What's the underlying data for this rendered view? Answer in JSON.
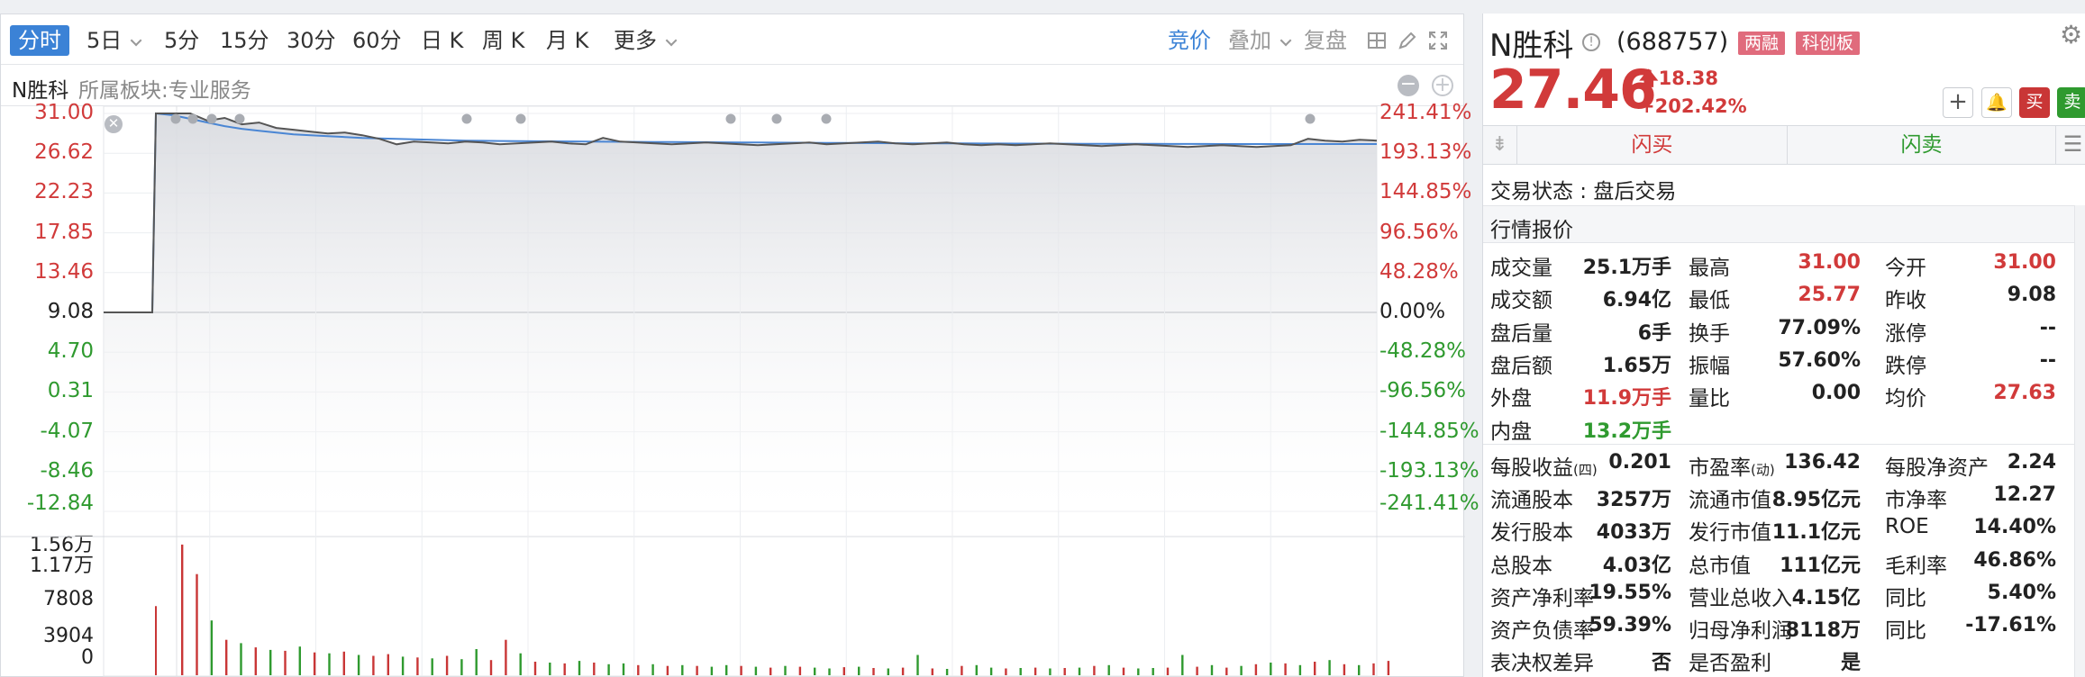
{
  "toolbar": {
    "period_tabs": [
      {
        "label": "分时",
        "active": true
      },
      {
        "label": "5日",
        "dropdown": true
      },
      {
        "label": "5分"
      },
      {
        "label": "15分"
      },
      {
        "label": "30分"
      },
      {
        "label": "60分"
      },
      {
        "label": "日 K"
      },
      {
        "label": "周 K"
      },
      {
        "label": "月 K"
      },
      {
        "label": "更多",
        "dropdown": true
      }
    ],
    "right_tools": {
      "auction": "竞价",
      "overlay": "叠加",
      "replay": "复盘"
    }
  },
  "chart_header": {
    "stock_short": "N胜科",
    "sector": "所属板块:专业服务"
  },
  "axes": {
    "price_left": [
      "31.00",
      "26.62",
      "22.23",
      "17.85",
      "13.46",
      "9.08",
      "4.70",
      "0.31",
      "-4.07",
      "-8.46",
      "-12.84"
    ],
    "pct_right": [
      "241.41%",
      "193.13%",
      "144.85%",
      "96.56%",
      "48.28%",
      "0.00%",
      "-48.28%",
      "-96.56%",
      "-144.85%",
      "-193.13%",
      "-241.41%"
    ],
    "volume_left": [
      "1.56万",
      "1.17万",
      "7808",
      "3904",
      "0"
    ]
  },
  "chart_data": {
    "type": "line",
    "prev_close": 9.08,
    "ylim": [
      -12.84,
      31.0
    ],
    "series": [
      {
        "name": "price",
        "color": "#555555",
        "values": [
          9.08,
          9.08,
          9.08,
          31.0,
          31.0,
          31.0,
          30.2,
          30.5,
          29.8,
          30.0,
          29.4,
          29.2,
          29.0,
          28.8,
          28.9,
          28.6,
          28.2,
          27.6,
          27.9,
          27.8,
          27.7,
          27.9,
          27.8,
          27.6,
          27.7,
          27.8,
          27.9,
          27.7,
          27.6,
          28.3,
          27.9,
          27.8,
          27.7,
          27.6,
          27.7,
          27.8,
          27.7,
          27.6,
          27.5,
          27.6,
          27.7,
          27.8,
          27.6,
          27.7,
          27.8,
          27.9,
          27.7,
          27.6,
          27.7,
          27.8,
          27.6,
          27.5,
          27.6,
          27.5,
          27.6,
          27.7,
          27.6,
          27.5,
          27.4,
          27.5,
          27.6,
          27.5,
          27.4,
          27.3,
          27.4,
          27.5,
          27.4,
          27.3,
          27.4,
          27.5,
          28.2,
          28.0,
          27.9,
          28.1,
          28.0
        ]
      },
      {
        "name": "avg",
        "color": "#4a86d4",
        "values": [
          9.08,
          9.08,
          9.08,
          31.0,
          30.8,
          30.4,
          30.0,
          29.6,
          29.3,
          29.1,
          28.9,
          28.7,
          28.6,
          28.5,
          28.4,
          28.3,
          28.25,
          28.2,
          28.15,
          28.1,
          28.05,
          28.0,
          27.98,
          27.96,
          27.95,
          27.94,
          27.93,
          27.92,
          27.9,
          27.89,
          27.88,
          27.87,
          27.86,
          27.85,
          27.84,
          27.83,
          27.82,
          27.81,
          27.8,
          27.79,
          27.78,
          27.77,
          27.76,
          27.75,
          27.74,
          27.73,
          27.72,
          27.71,
          27.71,
          27.7,
          27.7,
          27.69,
          27.69,
          27.68,
          27.68,
          27.67,
          27.67,
          27.66,
          27.66,
          27.65,
          27.65,
          27.65,
          27.64,
          27.64,
          27.64,
          27.63,
          27.63,
          27.63,
          27.63,
          27.63,
          27.63,
          27.63,
          27.63,
          27.63,
          27.63
        ]
      }
    ],
    "volume": {
      "ylim": [
        0,
        15600
      ],
      "values": [
        15500,
        12000,
        6500,
        4200,
        3800,
        3300,
        3000,
        2900,
        3400,
        2700,
        2600,
        2800,
        2400,
        2300,
        2500,
        2200,
        2100,
        2000,
        2300,
        1900,
        3100,
        1800,
        4200,
        2600,
        1600,
        1500,
        1400,
        1700,
        1500,
        1300,
        1400,
        1200,
        1300,
        1100,
        1200,
        1100,
        1000,
        1200,
        1100,
        1000,
        900,
        1100,
        1000,
        900,
        800,
        950,
        1000,
        850,
        800,
        900,
        2400,
        800,
        750,
        1100,
        1200,
        900,
        800,
        850,
        900,
        800,
        850,
        900,
        1100,
        1200,
        900,
        800,
        850,
        900,
        2400,
        1000,
        1200,
        900,
        1100,
        1300,
        1500,
        1400,
        1200,
        1600,
        1800,
        1300,
        1200,
        1400,
        1700
      ],
      "colors_red": [
        true,
        true,
        false,
        true,
        false,
        true,
        false,
        true,
        false,
        true,
        false,
        true,
        false,
        true,
        true,
        false,
        true,
        false,
        true,
        false,
        false,
        true,
        true,
        false,
        true,
        false,
        true,
        false,
        true,
        false,
        false,
        true,
        false,
        true,
        false,
        true,
        false,
        false,
        true,
        false,
        true,
        false,
        true,
        false,
        false,
        true,
        false,
        true,
        false,
        true,
        false,
        true,
        false,
        true,
        false,
        false,
        true,
        false,
        true,
        false,
        true,
        false,
        true,
        false,
        true,
        false,
        false,
        true,
        false,
        true,
        false,
        true,
        false,
        true,
        false,
        true,
        false,
        true,
        false,
        true,
        false,
        true,
        true
      ]
    }
  },
  "quote": {
    "name": "N胜科",
    "code": "(688757)",
    "badges": [
      "两融",
      "科创板"
    ],
    "price": "27.46",
    "change": "18.38",
    "change_pct": "+202.42%",
    "buy_label": "买",
    "sell_label": "卖",
    "flash_buy": "闪买",
    "flash_sell": "闪卖",
    "status_label": "交易状态 : 盘后交易",
    "section_title": "行情报价",
    "rows": [
      [
        {
          "l": "成交量",
          "v": "25.1万手",
          "c": ""
        },
        {
          "l": "最高",
          "v": "31.00",
          "c": "red"
        },
        {
          "l": "今开",
          "v": "31.00",
          "c": "red"
        }
      ],
      [
        {
          "l": "成交额",
          "v": "6.94亿",
          "c": ""
        },
        {
          "l": "最低",
          "v": "25.77",
          "c": "red"
        },
        {
          "l": "昨收",
          "v": "9.08",
          "c": ""
        }
      ],
      [
        {
          "l": "盘后量",
          "v": "6手",
          "c": ""
        },
        {
          "l": "换手",
          "v": "77.09%",
          "c": ""
        },
        {
          "l": "涨停",
          "v": "--",
          "c": ""
        }
      ],
      [
        {
          "l": "盘后额",
          "v": "1.65万",
          "c": ""
        },
        {
          "l": "振幅",
          "v": "57.60%",
          "c": ""
        },
        {
          "l": "跌停",
          "v": "--",
          "c": ""
        }
      ],
      [
        {
          "l": "外盘",
          "v": "11.9万手",
          "c": "red"
        },
        {
          "l": "量比",
          "v": "0.00",
          "c": ""
        },
        {
          "l": "均价",
          "v": "27.63",
          "c": "red"
        }
      ],
      [
        {
          "l": "内盘",
          "v": "13.2万手",
          "c": "green"
        }
      ]
    ],
    "fin_rows": [
      [
        {
          "l": "每股收益",
          "sub": "(四)",
          "v": "0.201"
        },
        {
          "l": "市盈率",
          "sub": "(动)",
          "v": "136.42"
        },
        {
          "l": "每股净资产",
          "v": "2.24"
        }
      ],
      [
        {
          "l": "流通股本",
          "v": "3257万"
        },
        {
          "l": "流通市值",
          "v": "8.95亿元"
        },
        {
          "l": "市净率",
          "v": "12.27"
        }
      ],
      [
        {
          "l": "发行股本",
          "v": "4033万"
        },
        {
          "l": "发行市值",
          "v": "11.1亿元"
        },
        {
          "l": "ROE",
          "v": "14.40%"
        }
      ],
      [
        {
          "l": "总股本",
          "v": "4.03亿"
        },
        {
          "l": "总市值",
          "v": "111亿元"
        },
        {
          "l": "毛利率",
          "v": "46.86%"
        }
      ],
      [
        {
          "l": "资产净利率",
          "v": "19.55%"
        },
        {
          "l": "营业总收入",
          "v": "4.15亿"
        },
        {
          "l": "同比",
          "v": "5.40%"
        }
      ],
      [
        {
          "l": "资产负债率",
          "v": "59.39%"
        },
        {
          "l": "归母净利润",
          "v": "8118万"
        },
        {
          "l": "同比",
          "v": "-17.61%"
        }
      ],
      [
        {
          "l": "表决权差异",
          "v": "否"
        },
        {
          "l": "是否盈利",
          "v": "是"
        }
      ]
    ]
  },
  "colors": {
    "up": "#d13a3a",
    "down": "#2f9a2f",
    "accent": "#3b82d6"
  }
}
